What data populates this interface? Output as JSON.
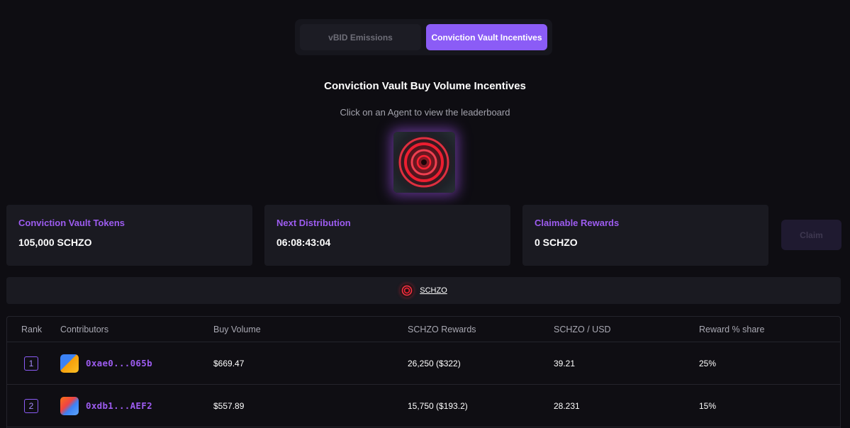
{
  "tabs": [
    {
      "label": "vBID Emissions",
      "active": false
    },
    {
      "label": "Conviction Vault Incentives",
      "active": true
    }
  ],
  "heading": "Conviction Vault Buy Volume Incentives",
  "subheading": "Click on an Agent to view the leaderboard",
  "agent": {
    "icon": "red-vortex-agent-icon"
  },
  "cards": {
    "tokens": {
      "label": "Conviction Vault Tokens",
      "value": "105,000 SCHZO"
    },
    "distribution": {
      "label": "Next Distribution",
      "value": "06:08:43:04"
    },
    "claimable": {
      "label": "Claimable Rewards",
      "value": "0 SCHZO"
    }
  },
  "claim_label": "Claim",
  "token_filter": {
    "symbol": "SCHZO",
    "icon": "schzo-token-icon"
  },
  "table": {
    "headers": {
      "rank": "Rank",
      "contributors": "Contributors",
      "buy_volume": "Buy Volume",
      "rewards": "SCHZO Rewards",
      "usd": "SCHZO / USD",
      "share": "Reward % share"
    },
    "rows": [
      {
        "rank": "1",
        "address": "0xae0...065b",
        "buy_volume": "$669.47",
        "rewards": "26,250 ($322)",
        "usd": "39.21",
        "share": "25%"
      },
      {
        "rank": "2",
        "address": "0xdb1...AEF2",
        "buy_volume": "$557.89",
        "rewards": "15,750 ($193.2)",
        "usd": "28.231",
        "share": "15%"
      }
    ]
  },
  "colors": {
    "accent": "#8b5cf6",
    "background": "#0e0d12",
    "card": "#1a1a21"
  }
}
